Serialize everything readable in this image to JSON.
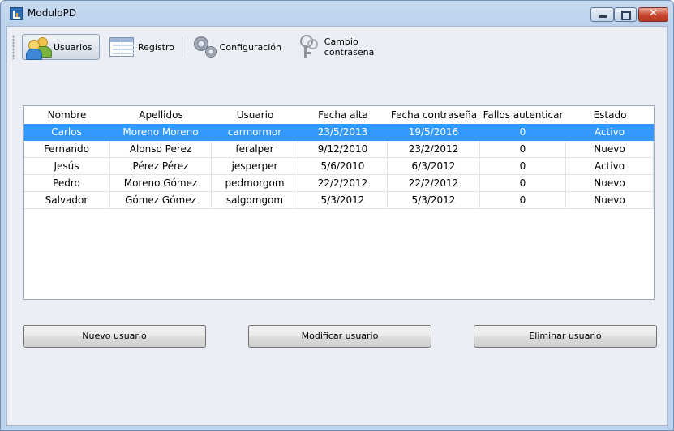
{
  "window": {
    "title": "ModuloPD"
  },
  "toolbar": {
    "usuarios": "Usuarios",
    "registro": "Registro",
    "configuracion": "Configuración",
    "cambio_contrasena": "Cambio contraseña"
  },
  "table": {
    "headers": [
      "Nombre",
      "Apellidos",
      "Usuario",
      "Fecha alta",
      "Fecha contraseña",
      "Fallos autenticar",
      "Estado"
    ],
    "rows": [
      [
        "Carlos",
        "Moreno Moreno",
        "carmormor",
        "23/5/2013",
        "19/5/2016",
        "0",
        "Activo"
      ],
      [
        "Fernando",
        "Alonso Perez",
        "feralper",
        "9/12/2010",
        "23/2/2012",
        "0",
        "Nuevo"
      ],
      [
        "Jesús",
        "Pérez Pérez",
        "jesperper",
        "5/6/2010",
        "6/3/2012",
        "0",
        "Activo"
      ],
      [
        "Pedro",
        "Moreno Gómez",
        "pedmorgom",
        "22/2/2012",
        "22/2/2012",
        "0",
        "Nuevo"
      ],
      [
        "Salvador",
        "Gómez Gómez",
        "salgomgom",
        "5/3/2012",
        "5/3/2012",
        "0",
        "Nuevo"
      ]
    ],
    "selected_row": 0
  },
  "actions": {
    "nuevo": "Nuevo usuario",
    "modificar": "Modificar usuario",
    "eliminar": "Eliminar usuario"
  },
  "colors": {
    "selection": "#3399ff"
  }
}
